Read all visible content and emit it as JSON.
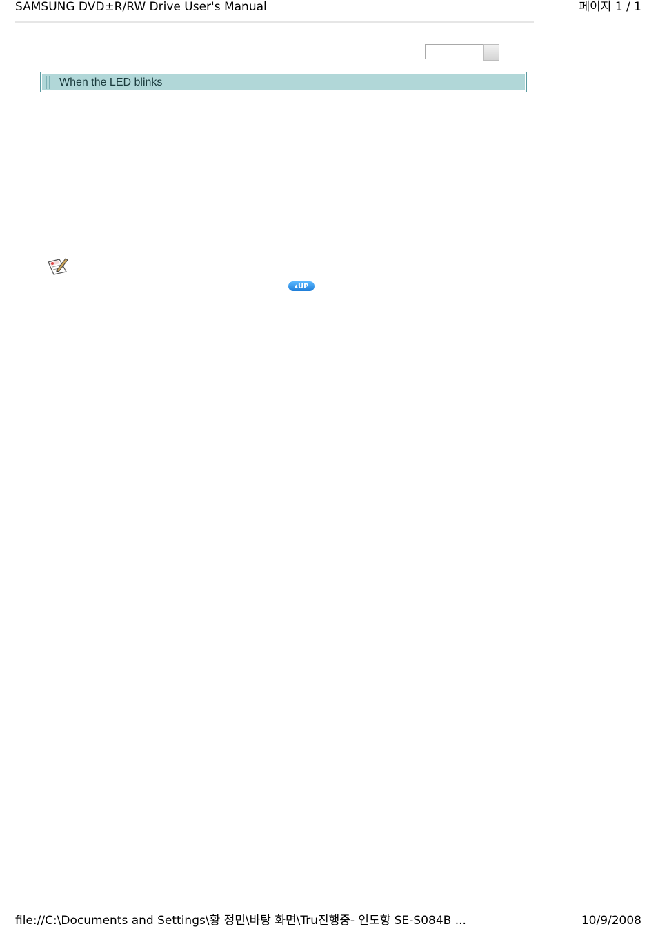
{
  "header": {
    "title": "SAMSUNG DVD±R/RW Drive User's Manual",
    "page_indicator": "페이지 1 / 1"
  },
  "section": {
    "title": "When the LED blinks"
  },
  "navigation": {
    "up_label": "UP"
  },
  "icons": {
    "note": "note-pencil-icon",
    "up": "up-arrow-icon"
  },
  "footer": {
    "path": "file://C:\\Documents and Settings\\황 정민\\바탕 화면\\Tru진행중- 인도향 SE-S084B ...",
    "date": "10/9/2008"
  }
}
